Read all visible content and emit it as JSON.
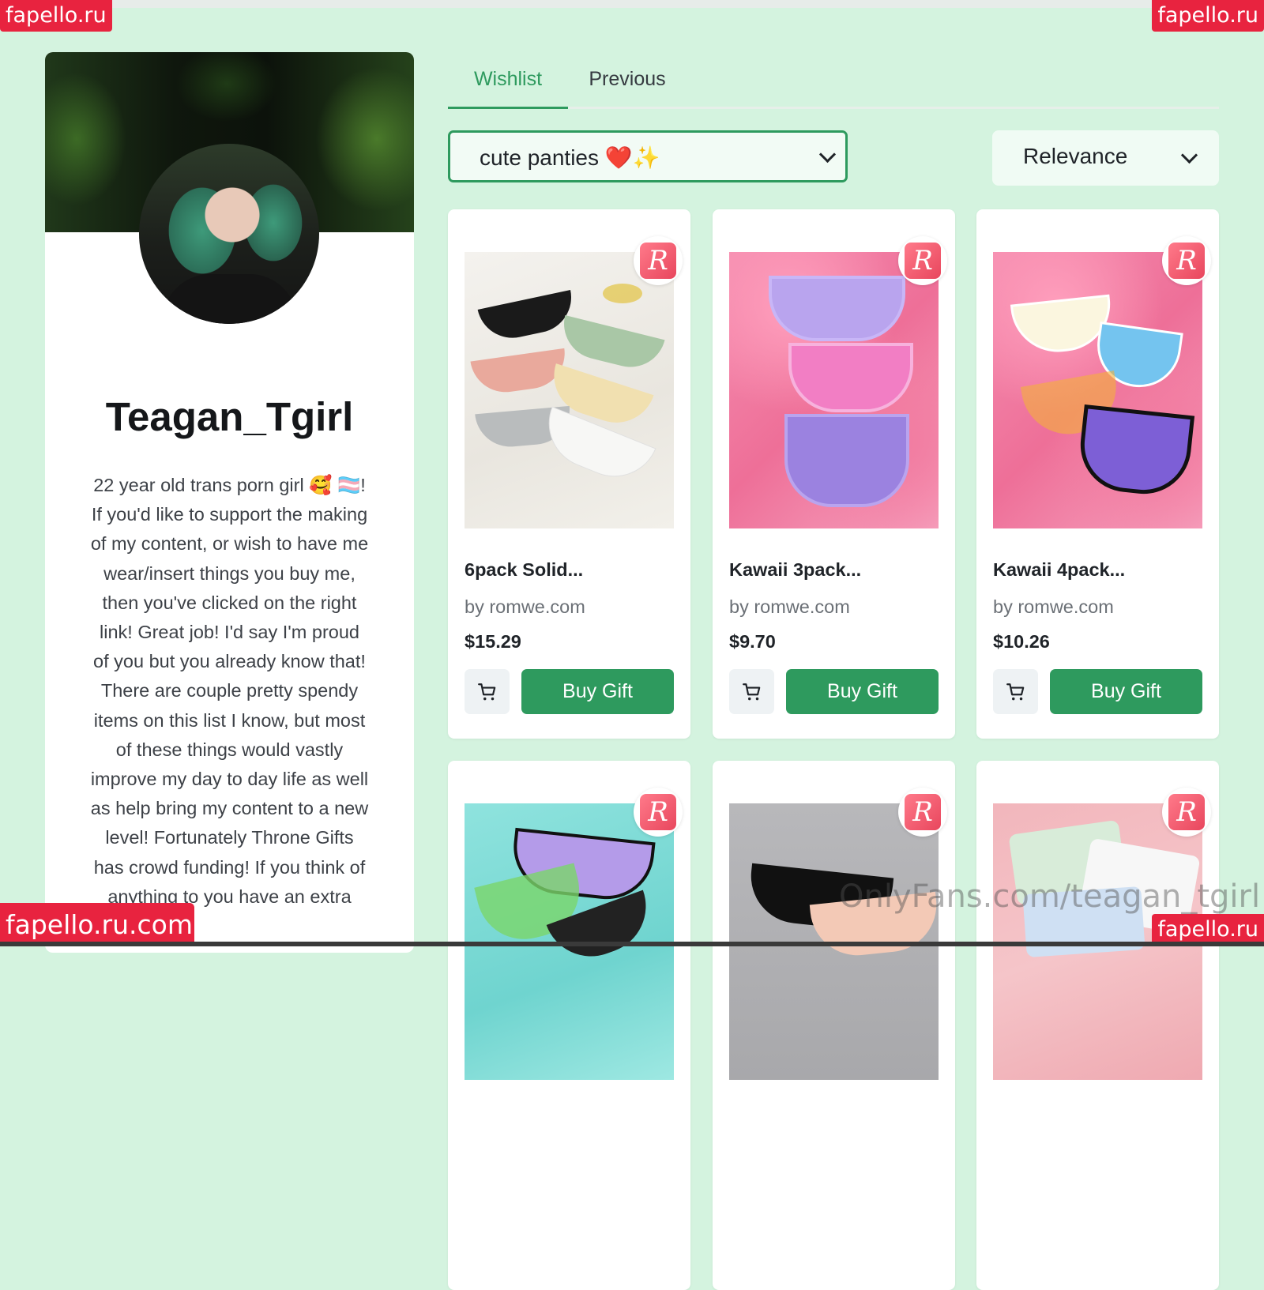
{
  "watermarks": {
    "top_left": "fapello.ru",
    "top_right": "fapello.ru",
    "bottom_right": "fapello.ru",
    "bottom_left": "fapello.ru.com",
    "overlay": "OnlyFans.com/teagan_tgirl"
  },
  "profile": {
    "username": "Teagan_Tgirl",
    "bio": "22 year old trans porn girl 🥰 🏳️‍⚧️! If you'd like to support the making of my content, or wish to have me wear/insert things you buy me, then you've clicked on the right link! Great job! I'd say I'm proud of you but you already know that! There are couple pretty spendy items on this list I know, but most of these things would vastly improve my day to day life as well as help bring my content to a new level! Fortunately Throne Gifts has crowd funding! If you think of anything to you have an extra"
  },
  "tabs": [
    {
      "label": "Wishlist",
      "active": true
    },
    {
      "label": "Previous",
      "active": false
    }
  ],
  "filters": {
    "category": "cute panties ❤️✨",
    "sort": "Relevance"
  },
  "colors": {
    "accent": "#2e9a5e",
    "background": "#d4f3df",
    "watermark": "#e8233f"
  },
  "products": [
    {
      "name": "6pack Solid...",
      "store": "by romwe.com",
      "price": "$15.29",
      "cart_icon": "cart-icon",
      "buy_label": "Buy Gift",
      "badge": "R"
    },
    {
      "name": "Kawaii 3pack...",
      "store": "by romwe.com",
      "price": "$9.70",
      "cart_icon": "cart-icon",
      "buy_label": "Buy Gift",
      "badge": "R"
    },
    {
      "name": "Kawaii 4pack...",
      "store": "by romwe.com",
      "price": "$10.26",
      "cart_icon": "cart-icon",
      "buy_label": "Buy Gift",
      "badge": "R"
    },
    {
      "badge": "R"
    },
    {
      "badge": "R"
    },
    {
      "badge": "R"
    }
  ]
}
